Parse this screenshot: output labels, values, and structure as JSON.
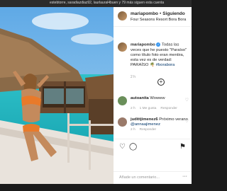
{
  "top_bar": {
    "text": "estebtorre, saradiazdiaz92, laurlaural4buen y 79 más siguen esta cuenta"
  },
  "post": {
    "username": "mariapombo",
    "separator": "•",
    "follow_label": "Siguiendo",
    "location": "Four Seasons Resort Bora Bora",
    "caption": {
      "username": "mariapombo",
      "verified_glyph": "✓",
      "text_before": "Todas las veces que he puesto \"Paraíso\" como título foto eran mentira, esta vez es de verdad: PARAÍSO 🌴 ",
      "hashtag": "#borabora",
      "time": "2 h"
    },
    "plus_glyph": "+",
    "comments": [
      {
        "username": "autoanita",
        "text": "Wowww",
        "time": "2 h",
        "likes": "1 Me gusta",
        "reply": "Responder"
      },
      {
        "username": "judittjimenez6",
        "text": "Próximo verano ",
        "mention": "@annaajimenez",
        "time": "2 h",
        "likes": "",
        "reply": "Responder"
      }
    ],
    "heart_glyph": "♡",
    "actions": {
      "like_glyph": "♡",
      "comment_glyph": "◯",
      "save_glyph": "⚑"
    },
    "add_comment_placeholder": "Añade un comentario...",
    "more_glyph": "···"
  },
  "colors": {
    "link": "#003569",
    "verified": "#3897f0",
    "muted": "#999999",
    "text": "#262626"
  }
}
